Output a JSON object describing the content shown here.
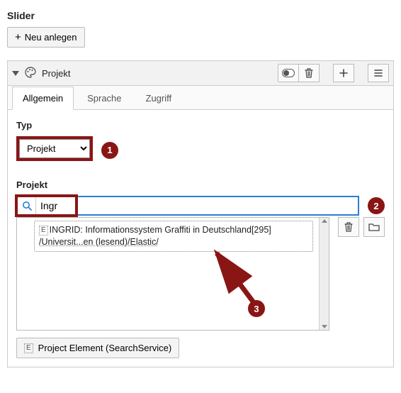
{
  "heading": "Slider",
  "newButton": "Neu anlegen",
  "panel": {
    "title": "Projekt",
    "tabs": [
      "Allgemein",
      "Sprache",
      "Zugriff"
    ],
    "activeTab": 0
  },
  "typ": {
    "label": "Typ",
    "value": "Projekt"
  },
  "projekt": {
    "label": "Projekt",
    "searchValue": "Ingr",
    "suggestion": {
      "badge": "E",
      "line1": "INGRID: Informationssystem Graffiti in Deutschland[295]",
      "line2": "/Universit...en (lesend)/Elastic/"
    }
  },
  "footerButton": {
    "badge": "E",
    "label": "Project Element (SearchService)"
  },
  "steps": {
    "s1": "1",
    "s2": "2",
    "s3": "3"
  }
}
